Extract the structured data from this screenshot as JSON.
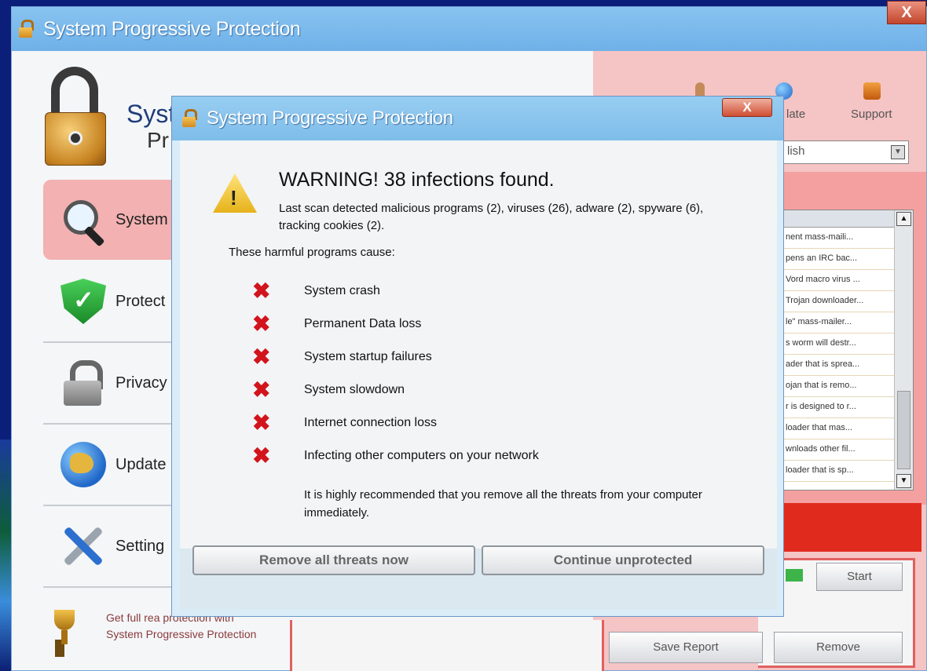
{
  "main_window": {
    "title": "System Progressive Protection",
    "close_label": "X",
    "brand_line1": "Syst",
    "brand_line2": "Pr",
    "nav": [
      {
        "label": "System",
        "icon": "magnifier-icon"
      },
      {
        "label": "Protect",
        "icon": "shield-icon"
      },
      {
        "label": "Privacy",
        "icon": "lock-icon"
      },
      {
        "label": "Update",
        "icon": "globe-icon"
      },
      {
        "label": "Setting",
        "icon": "tools-icon"
      }
    ],
    "promo_text": "Get full rea protection with System Progressive Protection",
    "top_links": [
      {
        "label": "",
        "icon": "user-icon"
      },
      {
        "label": "late",
        "icon": "update-globe-icon"
      },
      {
        "label": "Support",
        "icon": "support-icon"
      }
    ],
    "language_value": "lish",
    "threat_rows": [
      "nent mass-maili...",
      "pens an IRC bac...",
      "Vord macro virus ...",
      "Trojan downloader...",
      "le\" mass-mailer...",
      "s worm will destr...",
      "ader that is sprea...",
      "ojan that is remo...",
      "r is designed to r...",
      "loader that mas...",
      "wnloads other fil...",
      "loader that is sp..."
    ],
    "start_label": "Start",
    "save_report_label": "Save Report",
    "remove_label": "Remove"
  },
  "dialog": {
    "title": "System Progressive Protection",
    "close_label": "X",
    "heading": "WARNING! 38 infections found.",
    "subtext": "Last scan detected malicious programs (2), viruses (26), adware (2), spyware (6), tracking cookies (2).",
    "causes_label": "These harmful programs cause:",
    "causes": [
      "System crash",
      "Permanent Data loss",
      "System startup failures",
      "System slowdown",
      "Internet connection loss",
      "Infecting other computers on your network"
    ],
    "recommendation": "It is highly recommended that you remove all the threats from your computer immediately.",
    "remove_button": "Remove all threats now",
    "continue_button": "Continue unprotected"
  }
}
